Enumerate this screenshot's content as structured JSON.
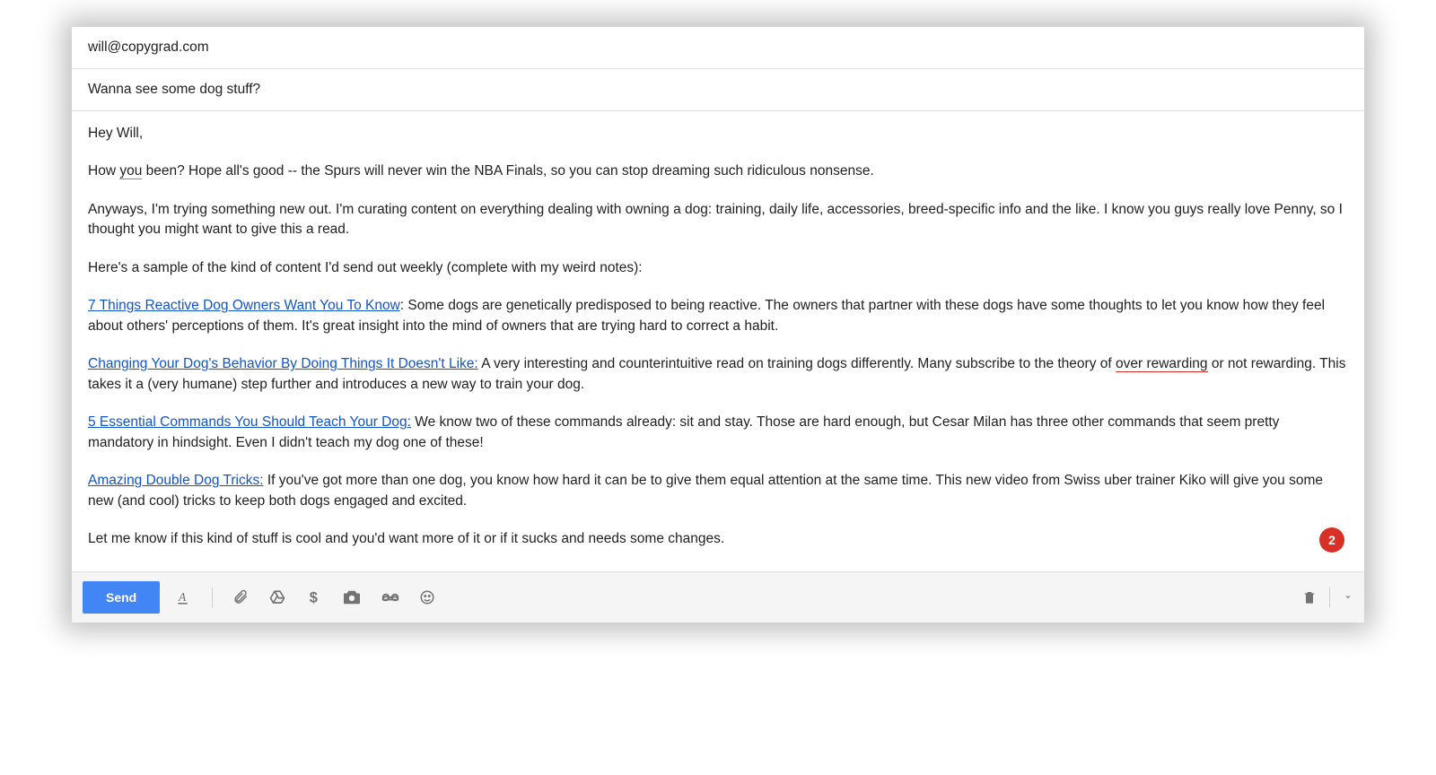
{
  "header": {
    "to": "will@copygrad.com",
    "subject": "Wanna see some dog stuff?"
  },
  "body": {
    "greeting": "Hey Will,",
    "p1_a": "How ",
    "p1_you": "you",
    "p1_b": " been? Hope all's good -- the Spurs will never win the NBA Finals, so you can stop dreaming such ridiculous nonsense.",
    "p2": "Anyways, I'm trying something new out. I'm curating content on everything dealing with owning a dog: training, daily life, accessories, breed-specific info and the like. I know you guys really love Penny, so I thought you might want to give this a read.",
    "p3": "Here's a sample of the kind of content I'd send out weekly (complete with my weird notes):",
    "items": [
      {
        "link": "7 Things Reactive Dog Owners Want You To Know",
        "sep": ": ",
        "desc": "Some dogs are genetically predisposed to being reactive. The owners that partner with these dogs have some thoughts to let you know how they feel about others' perceptions of them. It's great insight into the mind of owners that are trying hard to correct a habit."
      },
      {
        "link": "Changing Your Dog's Behavior By Doing Things It Doesn't Like:",
        "sep": " ",
        "desc_a": "A very interesting and counterintuitive read on training dogs differently. Many subscribe to the theory of ",
        "over": "over rewarding",
        "desc_b": " or not rewarding. This takes it a (very humane) step further and introduces a new way to train your dog."
      },
      {
        "link": "5 Essential Commands You Should Teach Your Dog:",
        "sep": " ",
        "desc": "We know two of these commands already: sit and stay. Those are hard enough, but Cesar Milan has three other commands that seem pretty mandatory in hindsight. Even I didn't teach my dog one of these!"
      },
      {
        "link": "Amazing Double Dog Tricks:",
        "sep": " ",
        "desc": "If you've got more than one dog, you know how hard it can be to give them equal attention at the same time. This new video from Swiss uber trainer Kiko will give you some new (and cool) tricks to keep both dogs engaged and excited."
      }
    ],
    "closing": "Let me know if this kind of stuff is cool and you'd want more of it or if it sucks and needs some changes."
  },
  "toolbar": {
    "send": "Send"
  },
  "badge": "2"
}
